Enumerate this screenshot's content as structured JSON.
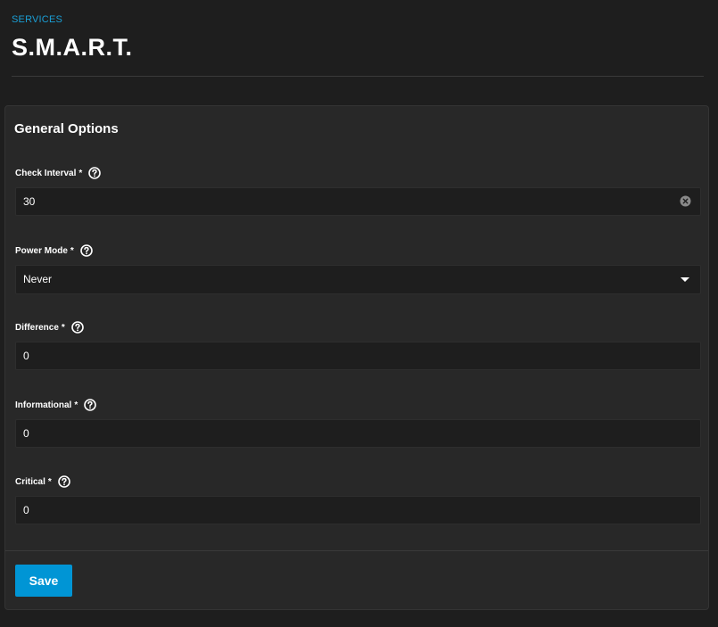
{
  "header": {
    "breadcrumb": "SERVICES",
    "title": "S.M.A.R.T."
  },
  "card": {
    "title": "General Options",
    "fields": [
      {
        "label": "Check Interval",
        "required": "*",
        "value": "30",
        "control": "input-clearable"
      },
      {
        "label": "Power Mode",
        "required": "*",
        "value": "Never",
        "control": "select"
      },
      {
        "label": "Difference",
        "required": "*",
        "value": "0",
        "control": "input"
      },
      {
        "label": "Informational",
        "required": "*",
        "value": "0",
        "control": "input"
      },
      {
        "label": "Critical",
        "required": "*",
        "value": "0",
        "control": "input"
      }
    ],
    "save_label": "Save"
  },
  "icons": {
    "help": "help-circle-icon",
    "clear": "clear-circle-icon",
    "dropdown": "caret-down-icon"
  },
  "colors": {
    "accent": "#0095d5",
    "breadcrumb": "#1a9fd6",
    "page_background": "#1e1e1e",
    "card_background": "#282828"
  }
}
